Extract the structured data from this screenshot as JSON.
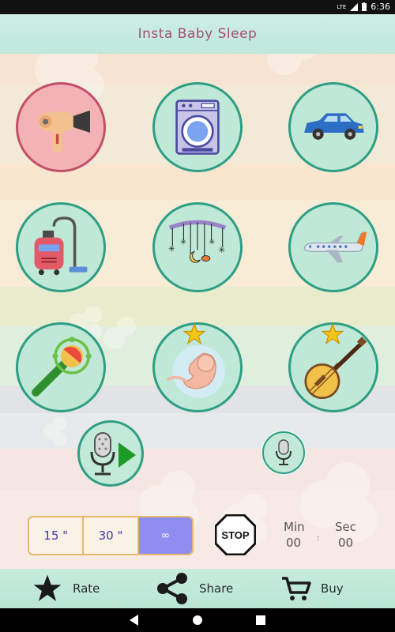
{
  "status_bar": {
    "network": "LTE",
    "time": "6:36"
  },
  "header": {
    "title": "Insta Baby Sleep"
  },
  "sounds": [
    {
      "name": "hair-dryer",
      "active": true
    },
    {
      "name": "washing-machine",
      "active": false
    },
    {
      "name": "car",
      "active": false
    },
    {
      "name": "vacuum-cleaner",
      "active": false
    },
    {
      "name": "baby-mobile",
      "active": false
    },
    {
      "name": "airplane",
      "active": false
    },
    {
      "name": "rattle",
      "active": false
    },
    {
      "name": "womb",
      "active": false,
      "premium": true
    },
    {
      "name": "banjo",
      "active": false,
      "premium": true
    }
  ],
  "timer": {
    "options": [
      "15 \"",
      "30 \"",
      "∞"
    ],
    "selected": "∞",
    "stop_label": "STOP",
    "min_label": "Min",
    "sec_label": "Sec",
    "min_value": "00",
    "separator": ":",
    "sec_value": "00"
  },
  "bottom_bar": {
    "rate_label": "Rate",
    "share_label": "Share",
    "buy_label": "Buy"
  },
  "colors": {
    "accent": "#2e9e84",
    "active": "#c2506a",
    "title": "#a4516e",
    "timer_selected": "#8e8ef0"
  }
}
